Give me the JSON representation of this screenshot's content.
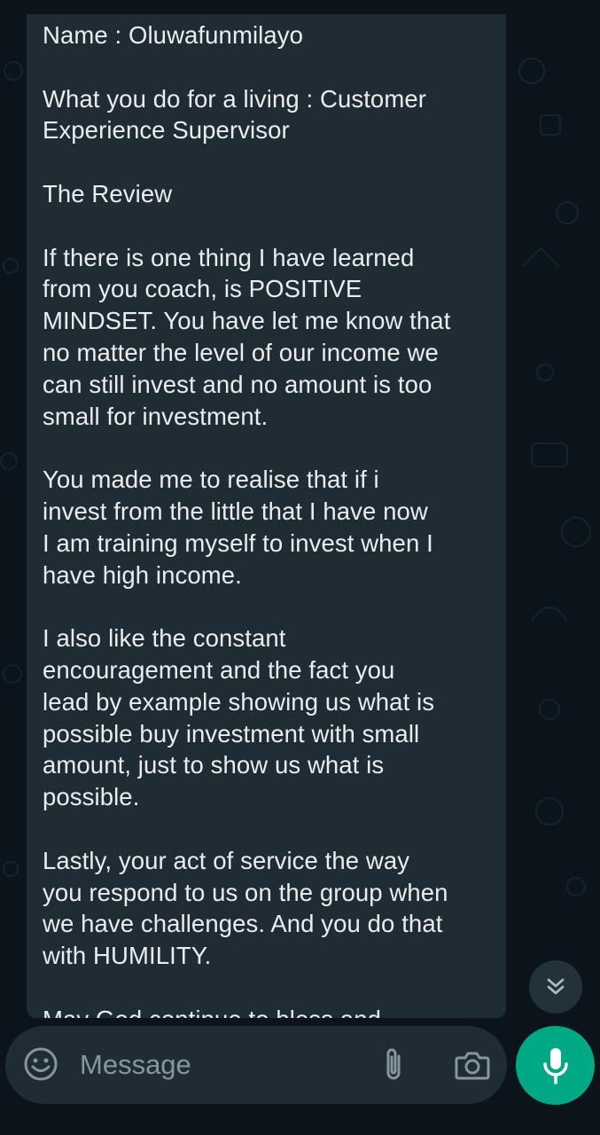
{
  "message": {
    "text": "Name : Oluwafunmilayo\n\nWhat you do for a living : Customer\nExperience Supervisor\n\nThe Review\n\nIf there is one thing I have learned\nfrom you coach, is POSITIVE\nMINDSET. You have let me know that\nno matter the level of our income we\ncan still invest and no amount is too\nsmall for investment.\n\nYou made me to realise that if i\ninvest from the little that I have now\nI am training myself to invest when I\nhave high income.\n\nI also like the constant\nencouragement and the fact you\nlead by example showing us what is\npossible buy investment with small\namount, just to show us what is\npossible.\n\nLastly, your act of service the way\nyou respond to us on the group when\nwe have challenges. And you do that\nwith HUMILITY.\n\nMay God continue to bless and"
  },
  "input": {
    "placeholder": "Message"
  },
  "icons": {
    "scroll": "double-chevron-down-icon",
    "emoji": "emoji-icon",
    "attach": "paperclip-icon",
    "camera": "camera-icon",
    "mic": "microphone-icon"
  },
  "colors": {
    "background": "#0b141a",
    "bubble": "#1f2c34",
    "text": "#e9edef",
    "placeholder": "#8696a0",
    "accent": "#00a884"
  }
}
